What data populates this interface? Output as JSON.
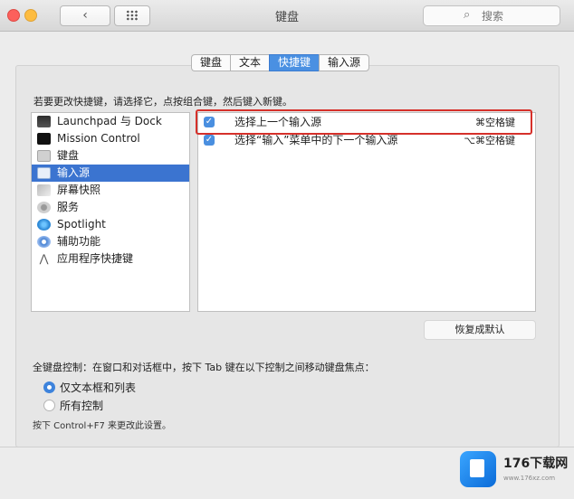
{
  "window": {
    "title": "键盘",
    "search_placeholder": "搜索",
    "back": "‹"
  },
  "tabs": [
    {
      "label": "键盘",
      "active": false
    },
    {
      "label": "文本",
      "active": false
    },
    {
      "label": "快捷键",
      "active": true
    },
    {
      "label": "输入源",
      "active": false
    }
  ],
  "hint": "若要更改快捷键，请选择它，点按组合键，然后键入新键。",
  "categories": [
    {
      "label": "Launchpad 与 Dock",
      "icon": "launchpad-icon",
      "selected": false
    },
    {
      "label": "Mission Control",
      "icon": "mission-control-icon",
      "selected": false
    },
    {
      "label": "键盘",
      "icon": "keyboard-icon",
      "selected": false
    },
    {
      "label": "输入源",
      "icon": "input-sources-icon",
      "selected": true
    },
    {
      "label": "屏幕快照",
      "icon": "screenshot-icon",
      "selected": false
    },
    {
      "label": "服务",
      "icon": "services-gear-icon",
      "selected": false
    },
    {
      "label": "Spotlight",
      "icon": "spotlight-icon",
      "selected": false
    },
    {
      "label": "辅助功能",
      "icon": "accessibility-icon",
      "selected": false
    },
    {
      "label": "应用程序快捷键",
      "icon": "app-shortcuts-icon",
      "selected": false
    }
  ],
  "shortcuts": [
    {
      "label": "选择上一个输入源",
      "key": "⌘空格键",
      "checked": true
    },
    {
      "label": "选择“输入”菜单中的下一个输入源",
      "key": "⌥⌘空格键",
      "checked": true
    }
  ],
  "restore_button": "恢复成默认",
  "full_keyboard": {
    "title": "全键盘控制：在窗口和对话框中，按下 Tab 键在以下控制之间移动键盘焦点：",
    "options": [
      {
        "label": "仅文本框和列表",
        "selected": true
      },
      {
        "label": "所有控制",
        "selected": false
      }
    ],
    "note": "按下 Control+F7 来更改此设置。"
  },
  "watermark": {
    "main": "176下载网",
    "sub": "www.176xz.com"
  },
  "colors": {
    "accent": "#3b74d0",
    "highlight_box": "#d6302a",
    "checkbox": "#4a8fe0"
  }
}
